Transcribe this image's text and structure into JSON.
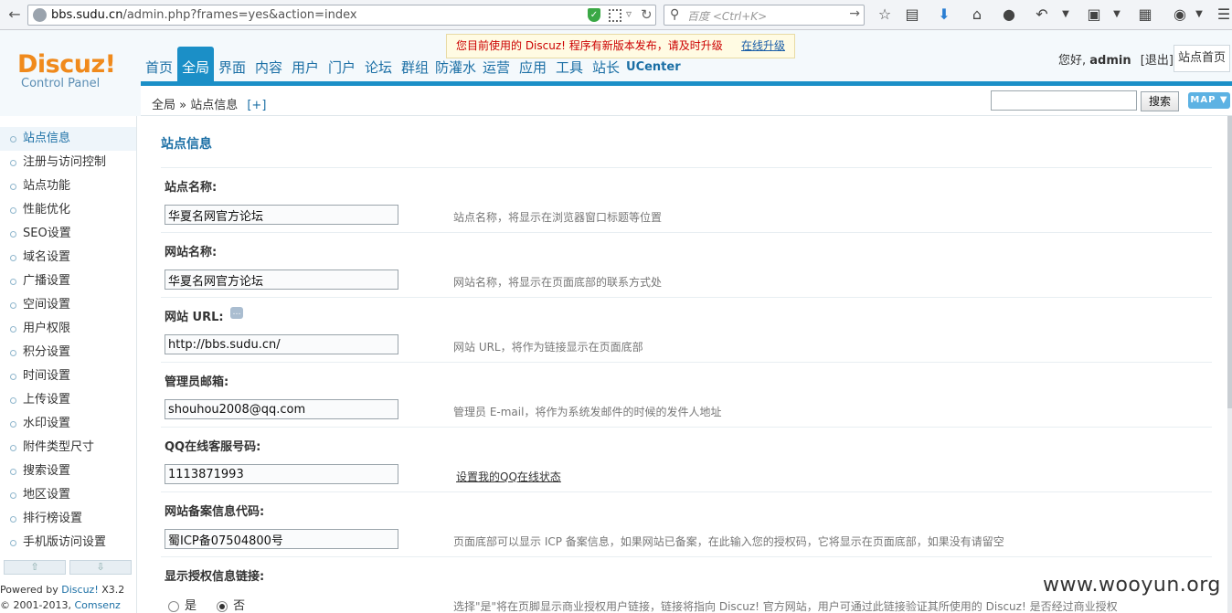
{
  "browser": {
    "url_host": "bbs.sudu.cn",
    "url_path": "/admin.php?frames=yes&action=index",
    "search_placeholder": "百度 <Ctrl+K>"
  },
  "header": {
    "logo_brand": "Discuz!",
    "logo_sub": "Control Panel",
    "notice_text": "您目前使用的 Discuz! 程序有新版本发布，请及时升级",
    "notice_link": "在线升级",
    "nav": [
      {
        "label": "首页",
        "active": false
      },
      {
        "label": "全局",
        "active": true
      },
      {
        "label": "界面",
        "active": false
      },
      {
        "label": "内容",
        "active": false
      },
      {
        "label": "用户",
        "active": false
      },
      {
        "label": "门户",
        "active": false
      },
      {
        "label": "论坛",
        "active": false
      },
      {
        "label": "群组",
        "active": false
      },
      {
        "label": "防灌水",
        "active": false
      },
      {
        "label": "运营",
        "active": false
      },
      {
        "label": "应用",
        "active": false
      },
      {
        "label": "工具",
        "active": false
      },
      {
        "label": "站长",
        "active": false
      },
      {
        "label": "UCenter",
        "active": false
      }
    ],
    "greeting": "您好,",
    "username": "admin",
    "logout": "[退出]",
    "site_home": "站点首页"
  },
  "subbar": {
    "breadcrumb": "全局 » 站点信息",
    "plus": "[+]",
    "search_button": "搜索",
    "map_button": "MAP"
  },
  "sidebar": {
    "items": [
      {
        "label": "站点信息",
        "active": true
      },
      {
        "label": "注册与访问控制",
        "active": false
      },
      {
        "label": "站点功能",
        "active": false
      },
      {
        "label": "性能优化",
        "active": false
      },
      {
        "label": "SEO设置",
        "active": false
      },
      {
        "label": "域名设置",
        "active": false
      },
      {
        "label": "广播设置",
        "active": false
      },
      {
        "label": "空间设置",
        "active": false
      },
      {
        "label": "用户权限",
        "active": false
      },
      {
        "label": "积分设置",
        "active": false
      },
      {
        "label": "时间设置",
        "active": false
      },
      {
        "label": "上传设置",
        "active": false
      },
      {
        "label": "水印设置",
        "active": false
      },
      {
        "label": "附件类型尺寸",
        "active": false
      },
      {
        "label": "搜索设置",
        "active": false
      },
      {
        "label": "地区设置",
        "active": false
      },
      {
        "label": "排行榜设置",
        "active": false
      },
      {
        "label": "手机版访问设置",
        "active": false
      }
    ],
    "powered_prefix": "Powered by ",
    "powered_link": "Discuz!",
    "powered_version": " X3.2",
    "copyright_prefix": "© 2001-2013, ",
    "copyright_link": "Comsenz Inc."
  },
  "content": {
    "title": "站点信息",
    "fields": [
      {
        "label": "站点名称:",
        "value": "华夏名网官方论坛",
        "tip": "站点名称，将显示在浏览器窗口标题等位置"
      },
      {
        "label": "网站名称:",
        "value": "华夏名网官方论坛",
        "tip": "网站名称，将显示在页面底部的联系方式处"
      },
      {
        "label": "网站 URL:",
        "value": "http://bbs.sudu.cn/",
        "tip": "网站 URL，将作为链接显示在页面底部"
      },
      {
        "label": "管理员邮箱:",
        "value": "shouhou2008@qq.com",
        "tip": "管理员 E-mail，将作为系统发邮件的时候的发件人地址"
      },
      {
        "label": "QQ在线客服号码:",
        "value": "1113871993",
        "tip": "设置我的QQ在线状态"
      },
      {
        "label": "网站备案信息代码:",
        "value": "蜀ICP备07504800号",
        "tip": "页面底部可以显示 ICP 备案信息，如果网站已备案，在此输入您的授权码，它将显示在页面底部，如果没有请留空"
      }
    ],
    "auth_field": {
      "label": "显示授权信息链接:",
      "opt_yes": "是",
      "opt_no": "否",
      "tip": "选择\"是\"将在页脚显示商业授权用户链接，链接将指向 Discuz! 官方网站，用户可通过此链接验证其所使用的 Discuz! 是否经过商业授权"
    }
  },
  "watermark": "www.wooyun.org"
}
